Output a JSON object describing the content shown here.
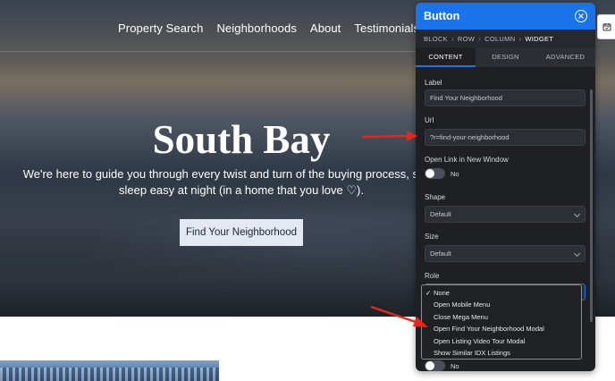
{
  "site": {
    "nav": [
      "Property Search",
      "Neighborhoods",
      "About",
      "Testimonials"
    ],
    "hero_title": "South Bay",
    "hero_subtitle": "We're here to guide you through every twist and turn of the buying process, so th can sleep easy at night (in a home that you love ♡).",
    "hero_button": "Find Your Neighborhood"
  },
  "panel": {
    "title": "Button",
    "breadcrumb": [
      "BLOCK",
      "ROW",
      "COLUMN",
      "WIDGET"
    ],
    "tabs": [
      "CONTENT",
      "DESIGN",
      "ADVANCED"
    ],
    "active_tab": "CONTENT",
    "fields": {
      "label": {
        "label": "Label",
        "value": "Find Your Neighborhood"
      },
      "url": {
        "label": "Url",
        "value": "?r=find-your-neighborhood"
      },
      "new_window": {
        "label": "Open Link in New Window",
        "state": "No"
      },
      "shape": {
        "label": "Shape",
        "value": "Default"
      },
      "size": {
        "label": "Size",
        "value": "Default"
      },
      "role": {
        "label": "Role"
      },
      "bottom_toggle": {
        "state": "No"
      }
    },
    "role_options": [
      "None",
      "Open Mobile Menu",
      "Close Mega Menu",
      "Open Find Your Neighborhood Modal",
      "Open Listing Video Tour Modal",
      "Show Similar IDX Listings"
    ],
    "role_selected": "None"
  },
  "colors": {
    "accent": "#1a73e8",
    "annotation_arrow": "#e0281c",
    "panel_bg": "#1e2024"
  },
  "icons": {
    "close": "close-circle-icon",
    "side_tab": "calendar-icon"
  }
}
